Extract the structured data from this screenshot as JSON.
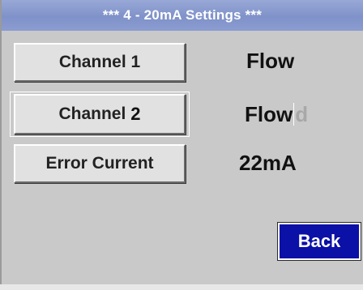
{
  "header": {
    "title": "***   4 - 20mA Settings  ***"
  },
  "buttons": {
    "channel1": "Channel 1",
    "channel2_text": "Channel",
    "channel2_num": "2",
    "error_current": "Error Current",
    "back": "Back"
  },
  "values": {
    "channel1": "Flow",
    "channel2": "Flow",
    "channel2_cursor_char": "d",
    "error_current": "22mA"
  },
  "colors": {
    "titlebar": "#8b9cd0",
    "background": "#c9c9c9",
    "back_button": "#0b10a6"
  }
}
